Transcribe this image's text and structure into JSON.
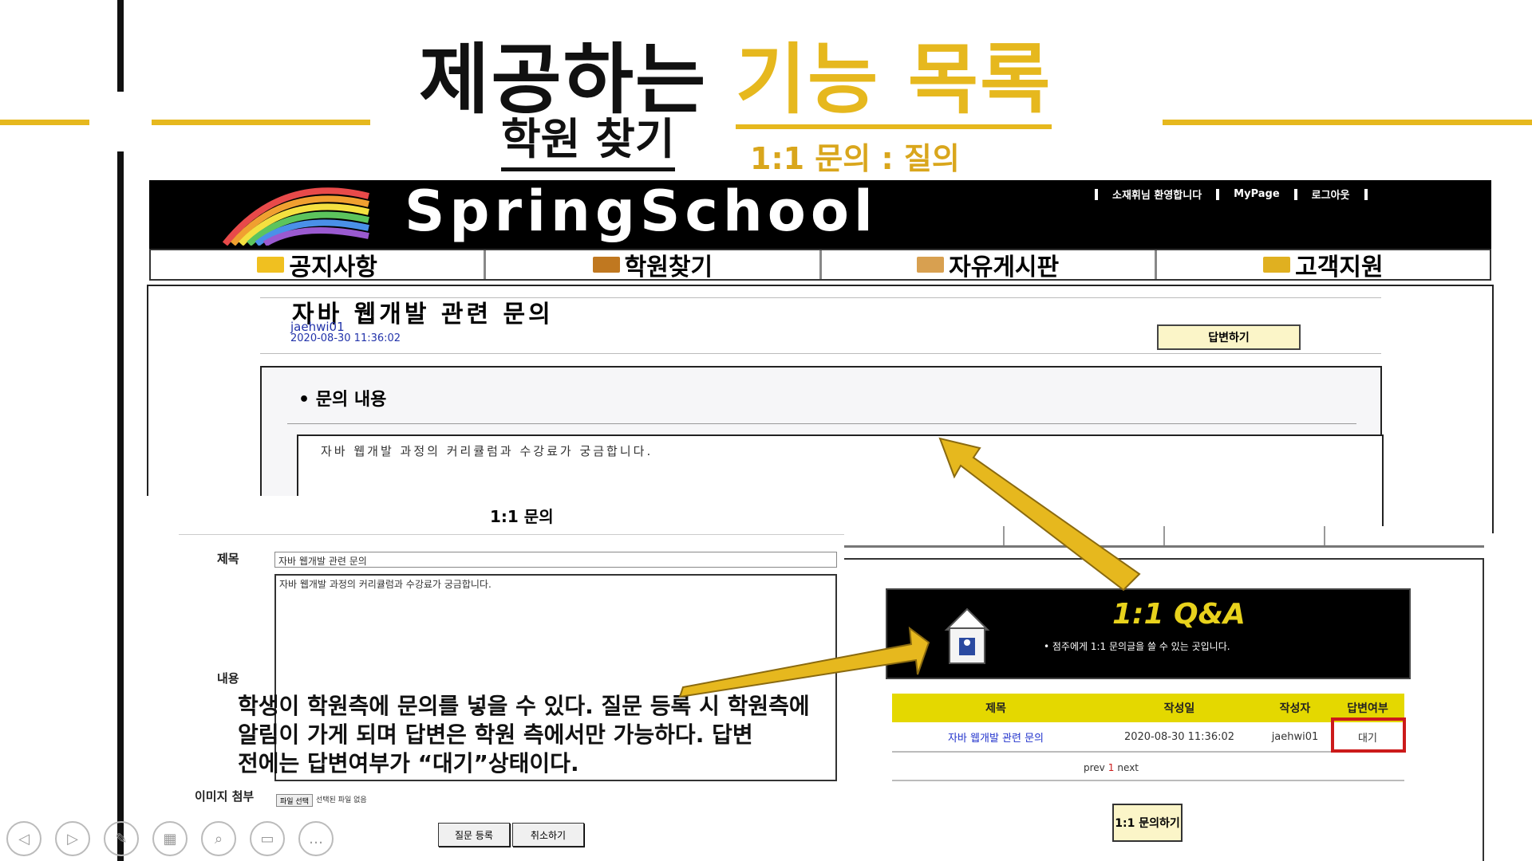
{
  "slide": {
    "title_black": "제공하는",
    "title_accent": "기능 목록",
    "subtitle": "학원 찾기",
    "subtitle_accent": "1:1 문의 : 질의"
  },
  "springschool": {
    "logo": "SpringSchool",
    "top_links": [
      "소재휘님 환영합니다",
      "MyPage",
      "로그아웃"
    ],
    "nav": [
      "공지사항",
      "학원찾기",
      "자유게시판",
      "고객지원"
    ]
  },
  "detail": {
    "title": "자바 웹개발 관련 문의",
    "author": "jaehwi01",
    "date": "2020-08-30 11:36:02",
    "answer_button": "답변하기",
    "section_label": "• 문의 내용",
    "content": "자바 웹개발 과정의 커리큘럼과 수강료가 궁금합니다."
  },
  "form": {
    "heading": "1:1 문의",
    "title_label": "제목",
    "title_value": "자바 웹개발 관련 문의",
    "content_label": "내용",
    "content_value": "자바 웹개발 과정의 커리큘럼과 수강료가 궁금합니다.",
    "attach_label": "이미지 첨부",
    "file_button": "파일 선택",
    "file_status": "선택된 파일 없음",
    "submit": "질문 등록",
    "cancel": "취소하기"
  },
  "callout": {
    "line1": "학생이 학원측에 문의를 넣을 수 있다. 질문 등록 시 학원측에",
    "line2": "알림이 가게 되며 답변은 학원 측에서만 가능하다. 답변",
    "line3": "전에는 답변여부가 “대기”상태이다."
  },
  "qna": {
    "title": "1:1 Q&A",
    "desc": "• 점주에게 1:1 문의글을 쓸 수 있는 곳입니다.",
    "columns": [
      "제목",
      "작성일",
      "작성자",
      "답변여부"
    ],
    "rows": [
      {
        "title": "자바 웹개발 관련 문의",
        "date": "2020-08-30 11:36:02",
        "author": "jaehwi01",
        "status": "대기"
      }
    ],
    "pagination": {
      "prev": "prev",
      "page": "1",
      "next": "next"
    },
    "write_button": "1:1 문의하기"
  },
  "colors": {
    "accent": "#e6b81e",
    "highlight_box": "#cc1a1a",
    "table_head": "#e4d800"
  }
}
